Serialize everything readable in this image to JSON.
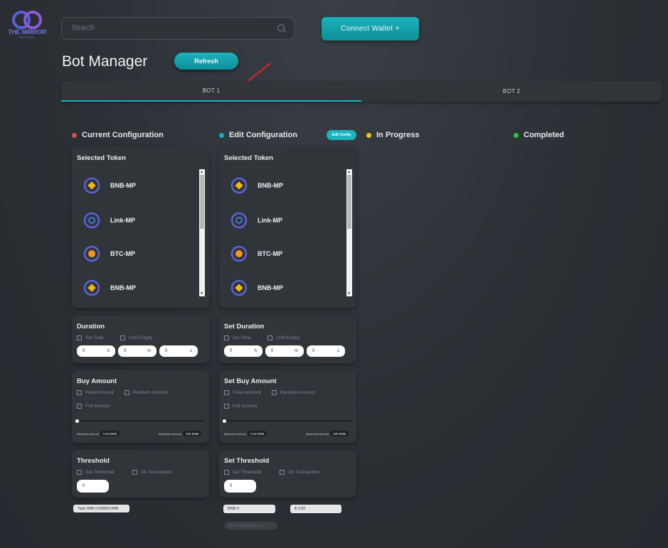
{
  "header": {
    "logo_text": "THE MIRROR",
    "logo_sub": "PROTOCOL",
    "search_placeholder": "Search",
    "wallet_label": "Connect Wallet +"
  },
  "page": {
    "title": "Bot Manager",
    "refresh_label": "Refresh"
  },
  "tabs": [
    {
      "label": "BOT 1",
      "active": true
    },
    {
      "label": "BOT 2",
      "active": false
    }
  ],
  "statuses": [
    {
      "label": "Current Configuration",
      "color": "#e0484f"
    },
    {
      "label": "Edit Configuration",
      "color": "#1aa7c8"
    },
    {
      "label": "In Progress",
      "color": "#f0c419"
    },
    {
      "label": "Completed",
      "color": "#2fc24c"
    }
  ],
  "edit_config_label": "Edit Config",
  "current": {
    "token_title": "Selected Token",
    "tokens": [
      {
        "name": "BNB-MP",
        "icon": "bnb-icon"
      },
      {
        "name": "Link-MP",
        "icon": "link-icon"
      },
      {
        "name": "BTC-MP",
        "icon": "btc-icon"
      },
      {
        "name": "BNB-MP",
        "icon": "bnb-icon"
      }
    ],
    "duration": {
      "title": "Duration",
      "opt1": "Set Time",
      "opt2": "Until Empty",
      "h_value": "0",
      "h_unit": "h",
      "m_value": "0",
      "m_unit": "m",
      "s_value": "0",
      "s_unit": "s"
    },
    "buy": {
      "title": "Buy Amount",
      "opt1": "Fixed Amount",
      "opt2": "Random Amount",
      "opt3": "Full Amount",
      "min_label": "Minimum Amount",
      "min_value": "0.02 BNB",
      "max_label": "Maximum Amount",
      "max_value": "100 BNB"
    },
    "threshold": {
      "title": "Threshold",
      "opt1": "Set Threshold",
      "opt2": "On Transaction",
      "value": "0"
    },
    "total": "Total: BNB 0.000000 BNB"
  },
  "edit": {
    "token_title": "Selected Token",
    "tokens": [
      {
        "name": "BNB-MP",
        "icon": "bnb-icon"
      },
      {
        "name": "Link-MP",
        "icon": "link-icon"
      },
      {
        "name": "BTC-MP",
        "icon": "btc-icon"
      },
      {
        "name": "BNB-MP",
        "icon": "bnb-icon"
      }
    ],
    "duration": {
      "title": "Set Duration",
      "opt1": "Set Time",
      "opt2": "Until Empty",
      "h_value": "0",
      "h_unit": "h",
      "m_value": "0",
      "m_unit": "m",
      "s_value": "0",
      "s_unit": "s"
    },
    "buy": {
      "title": "Set Buy Amount",
      "opt1": "Fixed Amount",
      "opt2": "Random Amount",
      "opt3": "Full Amount",
      "min_label": "Minimum Amount",
      "min_value": "0.02 BNB",
      "max_label": "Maximum Amount",
      "max_value": "100 BNB"
    },
    "threshold": {
      "title": "Set Threshold",
      "opt1": "Set Threshold",
      "opt2": "On Transaction",
      "value": "0"
    },
    "bnb_value": "BNB 0",
    "usd_value": "$ 0.00",
    "save_label": "Write Configuration ✕"
  },
  "colors": {
    "accent": "#1bb3bd",
    "bnb": "#f0b90b",
    "ring": "#5a62d8"
  }
}
